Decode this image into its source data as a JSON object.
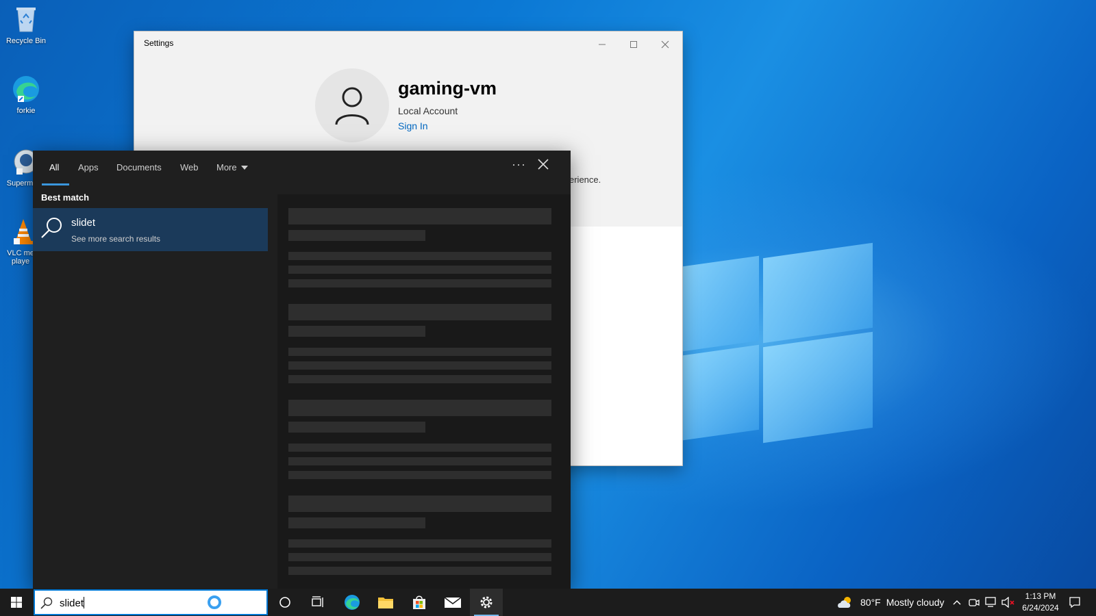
{
  "desktop": {
    "icons": [
      {
        "label": "Recycle Bin"
      },
      {
        "label": "forkie"
      },
      {
        "label": "Superm"
      },
      {
        "label": "VLC me playe"
      }
    ]
  },
  "settings_window": {
    "title": "Settings",
    "account_name": "gaming-vm",
    "account_type": "Local Account",
    "sign_in_link": "Sign In",
    "partial_text": "erience."
  },
  "search_panel": {
    "tabs": [
      {
        "label": "All",
        "active": true
      },
      {
        "label": "Apps"
      },
      {
        "label": "Documents"
      },
      {
        "label": "Web"
      },
      {
        "label": "More"
      }
    ],
    "more_options": "···",
    "section_header": "Best match",
    "best_match": {
      "title": "slidet",
      "subtitle": "See more search results"
    }
  },
  "taskbar": {
    "search_query": "slidet",
    "pinned": [
      "task-view",
      "edge",
      "file-explorer",
      "microsoft-store",
      "mail",
      "settings"
    ],
    "weather": {
      "temp": "80°F",
      "condition": "Mostly cloudy"
    },
    "clock": {
      "time": "1:13 PM",
      "date": "6/24/2024"
    }
  },
  "colors": {
    "accent": "#0078d4",
    "link": "#0067c0",
    "panel_bg": "#1f1f1f",
    "result_highlight": "#1b3a5a"
  }
}
